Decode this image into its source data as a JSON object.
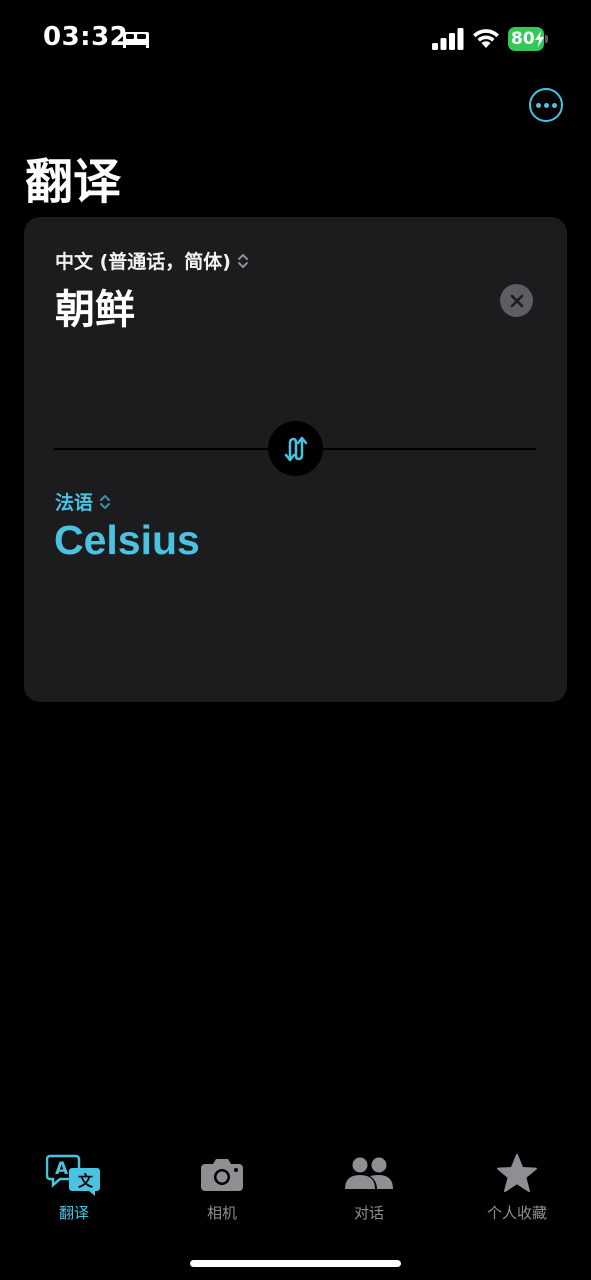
{
  "status_bar": {
    "time": "03:32",
    "battery_level": "80",
    "icons": [
      "bed-icon",
      "cellular-signal-icon",
      "wifi-icon",
      "battery-icon"
    ]
  },
  "header": {
    "title": "翻译",
    "more_icon": "ellipsis-circle-icon"
  },
  "translation": {
    "source_language": "中文 (普通话，简体)",
    "source_text": "朝鲜",
    "target_language": "法语",
    "target_text": "Celsius"
  },
  "tabs": [
    {
      "label": "翻译",
      "icon": "translate-icon",
      "active": true
    },
    {
      "label": "相机",
      "icon": "camera-icon",
      "active": false
    },
    {
      "label": "对话",
      "icon": "people-icon",
      "active": false
    },
    {
      "label": "个人收藏",
      "icon": "star-icon",
      "active": false
    }
  ],
  "colors": {
    "accent": "#4ac3e3",
    "card_bg": "#1c1c1e",
    "inactive_tab": "#8e8e93",
    "battery": "#34c759"
  }
}
